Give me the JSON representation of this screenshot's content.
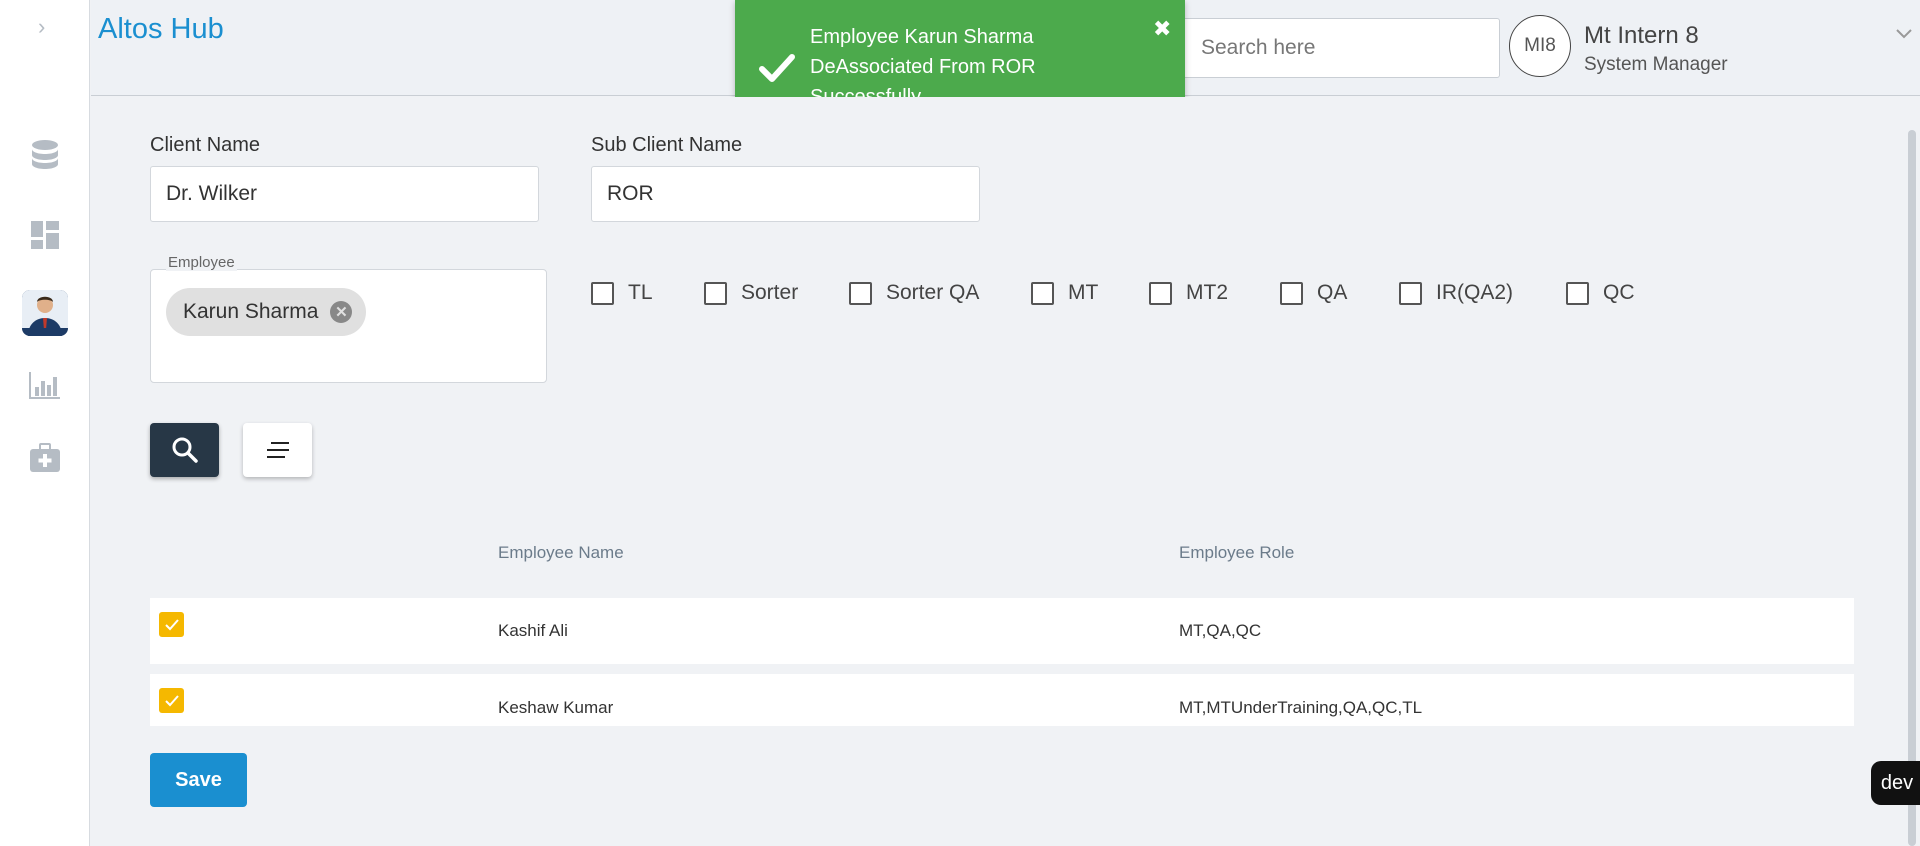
{
  "app": {
    "title": "Altos Hub"
  },
  "header": {
    "search_placeholder": "Search here",
    "user_initials": "MI8",
    "user_name": "Mt Intern 8",
    "user_role": "System Manager"
  },
  "toast": {
    "message": "Employee Karun Sharma DeAssociated From ROR Successfully",
    "color": "#4caa4c"
  },
  "form": {
    "client_label": "Client Name",
    "client_value": "Dr. Wilker",
    "sub_client_label": "Sub Client Name",
    "sub_client_value": "ROR",
    "employee_label": "Employee",
    "employee_chip": "Karun Sharma",
    "roles": [
      "TL",
      "Sorter",
      "Sorter QA",
      "MT",
      "MT2",
      "QA",
      "IR(QA2)",
      "QC"
    ]
  },
  "table": {
    "headers": {
      "name": "Employee Name",
      "role": "Employee Role"
    },
    "rows": [
      {
        "name": "Kashif Ali",
        "role": "MT,QA,QC",
        "checked": true
      },
      {
        "name": "Keshaw Kumar",
        "role": "MT,MTUnderTraining,QA,QC,TL",
        "checked": true
      }
    ]
  },
  "save_label": "Save",
  "dev_badge": "dev",
  "colors": {
    "accent": "#1a8fd0",
    "dark_button": "#273746",
    "checkbox_checked": "#f5b800"
  }
}
